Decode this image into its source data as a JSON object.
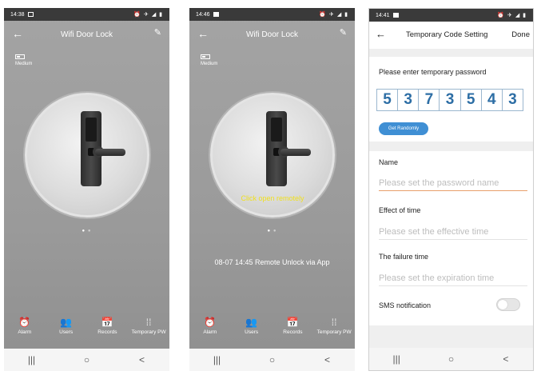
{
  "screen1": {
    "status": {
      "time": "14:38",
      "notif_icon": "image-icon",
      "right_icons": "⏰ ✈ ◢ ▮"
    },
    "appbar": {
      "back": "←",
      "title": "Wifi Door Lock",
      "edit": "✎"
    },
    "battery": {
      "label": "Medium"
    },
    "caption": "",
    "dots": {
      "active": "●",
      "inactive": "●"
    },
    "log": "",
    "tabs": [
      {
        "icon": "alarm-icon",
        "glyph": "⏰",
        "label": "Alarm"
      },
      {
        "icon": "users-icon",
        "glyph": "👥",
        "label": "Users"
      },
      {
        "icon": "calendar-icon",
        "glyph": "📅",
        "label": "Records"
      },
      {
        "icon": "grid-icon",
        "glyph": "⁞⁞",
        "label": "Temporary PW"
      }
    ],
    "nav": {
      "recents": "|||",
      "home": "○",
      "back": "<"
    }
  },
  "screen2": {
    "status": {
      "time": "14:46",
      "notif_icon": "image-icon",
      "right_icons": "⏰ ✈ ◢ ▮"
    },
    "appbar": {
      "back": "←",
      "title": "Wifi Door Lock",
      "edit": "✎"
    },
    "battery": {
      "label": "Medium"
    },
    "caption": "Click open remotely",
    "dots": {
      "active": "●",
      "inactive": "●"
    },
    "log": "08-07 14:45  Remote Unlock via App",
    "tabs": [
      {
        "icon": "alarm-icon",
        "glyph": "⏰",
        "label": "Alarm"
      },
      {
        "icon": "users-icon",
        "glyph": "👥",
        "label": "Users"
      },
      {
        "icon": "calendar-icon",
        "glyph": "📅",
        "label": "Records"
      },
      {
        "icon": "grid-icon",
        "glyph": "⁞⁞",
        "label": "Temporary PW"
      }
    ],
    "nav": {
      "recents": "|||",
      "home": "○",
      "back": "<"
    }
  },
  "screen3": {
    "status": {
      "time": "14:41",
      "notif_icon": "image-icon",
      "right_icons": "⏰ ✈ ◢ ▮"
    },
    "appbar": {
      "back": "←",
      "title": "Temporary Code Setting",
      "done": "Done"
    },
    "password_label": "Please enter temporary password",
    "digits": [
      "5",
      "3",
      "7",
      "3",
      "5",
      "4",
      "3"
    ],
    "random_button": "Get Randomly",
    "name": {
      "label": "Name",
      "placeholder": "Please set the password name"
    },
    "effect": {
      "label": "Effect of time",
      "placeholder": "Please set the effective time"
    },
    "failure": {
      "label": "The failure time",
      "placeholder": "Please set the expiration time"
    },
    "sms": {
      "label": "SMS notification",
      "enabled": false
    },
    "nav": {
      "recents": "|||",
      "home": "○",
      "back": "<"
    }
  },
  "colors": {
    "lock_bg": "#9a9a9a",
    "caption_yellow": "#f0e020",
    "digit_blue": "#2d6ea5",
    "button_blue": "#3f8fd4",
    "active_underline": "#e8a06b"
  }
}
